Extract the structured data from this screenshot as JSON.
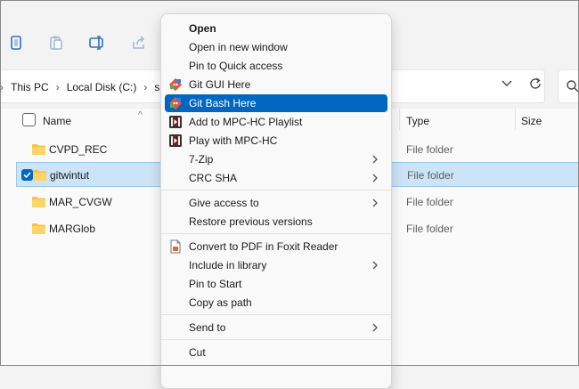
{
  "toolbar": {
    "icons": [
      "copy-icon",
      "paste-icon",
      "rename-icon",
      "share-icon"
    ]
  },
  "breadcrumb": {
    "items": [
      "This PC",
      "Local Disk (C:)",
      "s"
    ]
  },
  "columns": {
    "name": "Name",
    "type": "Type",
    "size": "Size"
  },
  "files": [
    {
      "name": "CVPD_REC",
      "type": "File folder",
      "selected": false
    },
    {
      "name": "gitwintut",
      "type": "File folder",
      "selected": true
    },
    {
      "name": "MAR_CVGW",
      "type": "File folder",
      "selected": false
    },
    {
      "name": "MARGlob",
      "type": "File folder",
      "selected": false
    }
  ],
  "menu": {
    "items": [
      {
        "label": "Open",
        "bold": true
      },
      {
        "label": "Open in new window"
      },
      {
        "label": "Pin to Quick access"
      },
      {
        "label": "Git GUI Here",
        "icon": "git-icon"
      },
      {
        "label": "Git Bash Here",
        "icon": "git-icon",
        "highlighted": true
      },
      {
        "label": "Add to MPC-HC Playlist",
        "icon": "mpc-hc-icon"
      },
      {
        "label": "Play with MPC-HC",
        "icon": "mpc-hc-icon"
      },
      {
        "label": "7-Zip",
        "submenu": true
      },
      {
        "label": "CRC SHA",
        "submenu": true
      },
      {
        "label": "Give access to",
        "submenu": true
      },
      {
        "label": "Restore previous versions"
      },
      {
        "label": "Convert to PDF in Foxit Reader",
        "icon": "foxit-icon"
      },
      {
        "label": "Include in library",
        "submenu": true
      },
      {
        "label": "Pin to Start"
      },
      {
        "label": "Copy as path"
      },
      {
        "label": "Send to",
        "submenu": true
      },
      {
        "label": "Cut"
      }
    ]
  },
  "colors": {
    "highlight": "#0067c0",
    "selection": "#cce4f7",
    "folder": "#f5c242"
  }
}
